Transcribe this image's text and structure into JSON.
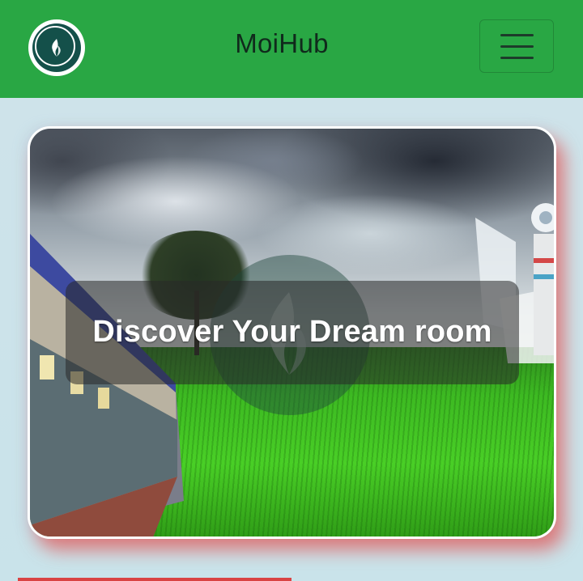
{
  "navbar": {
    "logo_icon": "flame-logo-icon",
    "brand": "MoiHub",
    "menu_icon": "hamburger-menu-icon",
    "background_color": "#29a744"
  },
  "hero": {
    "heading": "Discover Your Dream room",
    "watermark_icon": "flame-logo-icon",
    "image_subject": "rural-field-landscape"
  },
  "colors": {
    "accent_green": "#29a744",
    "logo_dark": "#14504a",
    "shadow_red": "#e25a5a",
    "page_background": "#c9e3ea"
  }
}
